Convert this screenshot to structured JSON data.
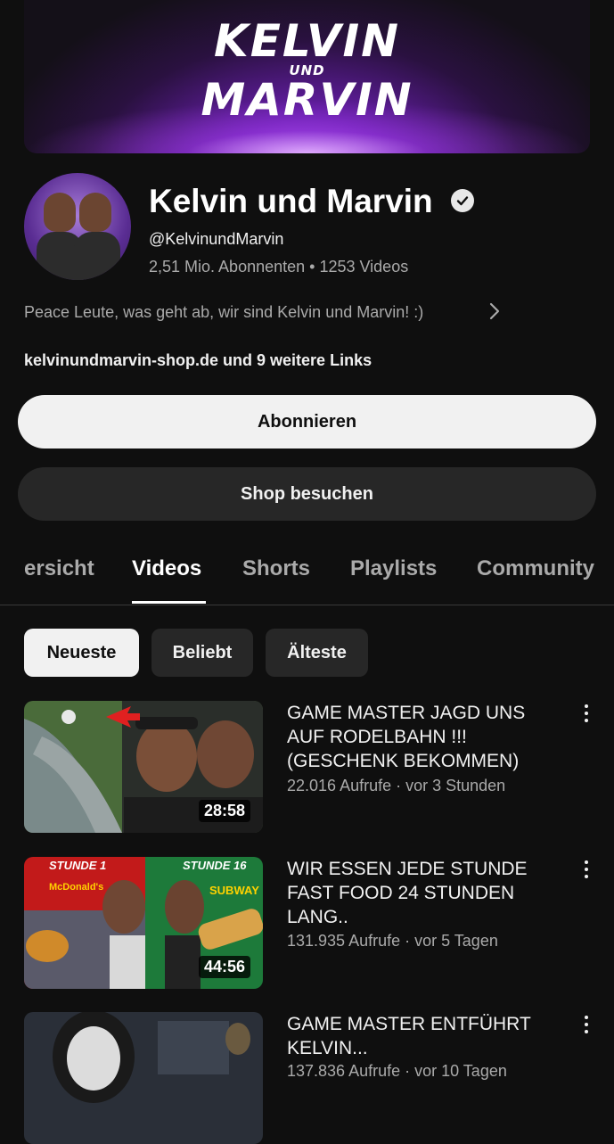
{
  "banner": {
    "line1": "KELVIN",
    "line2": "UND",
    "line3": "MARVIN"
  },
  "channel": {
    "title": "Kelvin und Marvin",
    "handle": "@KelvinundMarvin",
    "stats": "2,51 Mio. Abonnenten • 1253 Videos",
    "description": "Peace Leute, was geht ab, wir sind Kelvin und Marvin! :)",
    "links": "kelvinundmarvin-shop.de und 9 weitere Links"
  },
  "buttons": {
    "subscribe": "Abonnieren",
    "shop": "Shop besuchen"
  },
  "tabs": [
    "ersicht",
    "Videos",
    "Shorts",
    "Playlists",
    "Community"
  ],
  "active_tab": "Videos",
  "chips": [
    "Neueste",
    "Beliebt",
    "Älteste"
  ],
  "videos": [
    {
      "title": "GAME MASTER JAGD UNS AUF RODELBAHN !!! (GESCHENK BEKOMMEN)",
      "meta": "22.016 Aufrufe · vor 3 Stunden",
      "duration": "28:58"
    },
    {
      "title": "WIR ESSEN JEDE STUNDE FAST FOOD 24 STUNDEN LANG..",
      "meta": "131.935 Aufrufe · vor 5 Tagen",
      "duration": "44:56",
      "thumb_labels": {
        "left": "STUNDE 1",
        "right": "STUNDE 16",
        "brand_left": "McDonald's",
        "brand_right": "SUBWAY"
      }
    },
    {
      "title": "GAME MASTER ENTFÜHRT KELVIN...",
      "meta": "137.836 Aufrufe · vor 10 Tagen"
    }
  ],
  "icons": [
    "verified-badge-icon",
    "chevron-right-icon",
    "more-vert-icon"
  ],
  "colors": {
    "background": "#0f0f0f",
    "primary_text": "#f1f1f1",
    "secondary_text": "#aaaaaa",
    "chip_bg": "#272727",
    "accent_purple": "#8a3fd1"
  }
}
